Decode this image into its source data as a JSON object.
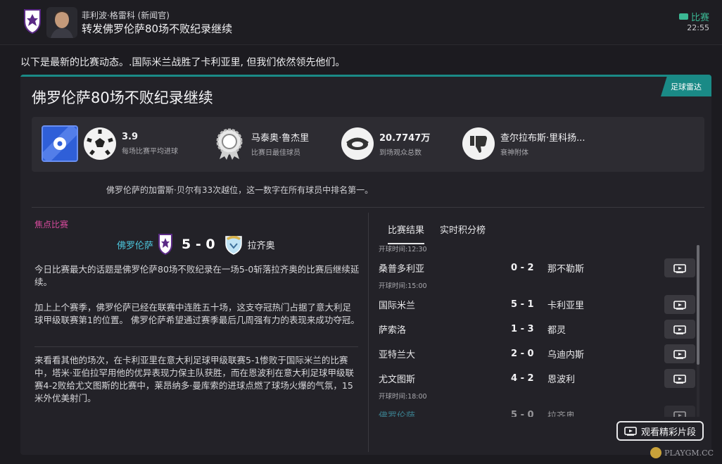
{
  "header": {
    "sender": "菲利波·格雷科 (新闻官)",
    "subject": "转发佛罗伦萨80场不败纪录继续",
    "tag": "比赛",
    "time": "22:55"
  },
  "intro": "以下是最新的比赛动态。.国际米兰战胜了卡利亚里, 但我们依然领先他们。",
  "card": {
    "source": "足球雷达",
    "title": "佛罗伦萨80场不败纪录继续",
    "stats": [
      {
        "icon": "football-icon",
        "value": "3.9",
        "label": "每场比赛平均进球"
      },
      {
        "icon": "medal-icon",
        "value": "马泰奥·鲁杰里",
        "label": "比赛日最佳球员"
      },
      {
        "icon": "stadium-icon",
        "value": "20.7747万",
        "label": "到场观众总数"
      },
      {
        "icon": "thumbs-down-icon",
        "value": "查尔拉布斯·里科扬...",
        "label": "衰神附体"
      }
    ],
    "note": "佛罗伦萨的加雷斯·贝尔有33次越位，这一数字在所有球员中排名第一。"
  },
  "focus": {
    "label": "焦点比赛",
    "home": "佛罗伦萨",
    "score": "5 - 0",
    "away": "拉齐奥",
    "paragraphs": [
      "今日比赛最大的话题是佛罗伦萨80场不败纪录在一场5-0斩落拉齐奥的比赛后继续延续。",
      "加上上个赛季，佛罗伦萨已经在联赛中连胜五十场，这支夺冠热门占据了意大利足球甲级联赛第1的位置。 佛罗伦萨希望通过赛季最后几周强有力的表现来成功夺冠。",
      "来看看其他的场次，在卡利亚里在意大利足球甲级联赛5-1惨败于国际米兰的比赛中，塔米·亚伯拉罕用他的优异表现力保主队获胜，而在恩波利在意大利足球甲级联赛4-2败给尤文图斯的比赛中，莱昂纳多·曼库索的进球点燃了球场火爆的气氛，15米外优美射门。"
    ]
  },
  "results": {
    "tabs": [
      "比赛结果",
      "实时积分榜"
    ],
    "slots": [
      {
        "time": "开球时间:12:30",
        "matches": [
          {
            "home": "桑普多利亚",
            "score": "0 - 2",
            "away": "那不勒斯"
          }
        ]
      },
      {
        "time": "开球时间:15:00",
        "matches": [
          {
            "home": "国际米兰",
            "score": "5 - 1",
            "away": "卡利亚里"
          },
          {
            "home": "萨索洛",
            "score": "1 - 3",
            "away": "都灵"
          },
          {
            "home": "亚特兰大",
            "score": "2 - 0",
            "away": "乌迪内斯"
          },
          {
            "home": "尤文图斯",
            "score": "4 - 2",
            "away": "恩波利"
          }
        ]
      },
      {
        "time": "开球时间:18:00",
        "matches": [
          {
            "home": "佛罗伦萨",
            "score": "5 - 0",
            "away": "拉齐奥"
          }
        ]
      }
    ],
    "watch_label": "观看精彩片段"
  },
  "watermark": "PLAYGM.CC",
  "colors": {
    "accent_teal": "#1a8a86",
    "home_highlight": "#4cc3d9",
    "focus_pink": "#d94b9e",
    "tag_green": "#3bb894"
  }
}
